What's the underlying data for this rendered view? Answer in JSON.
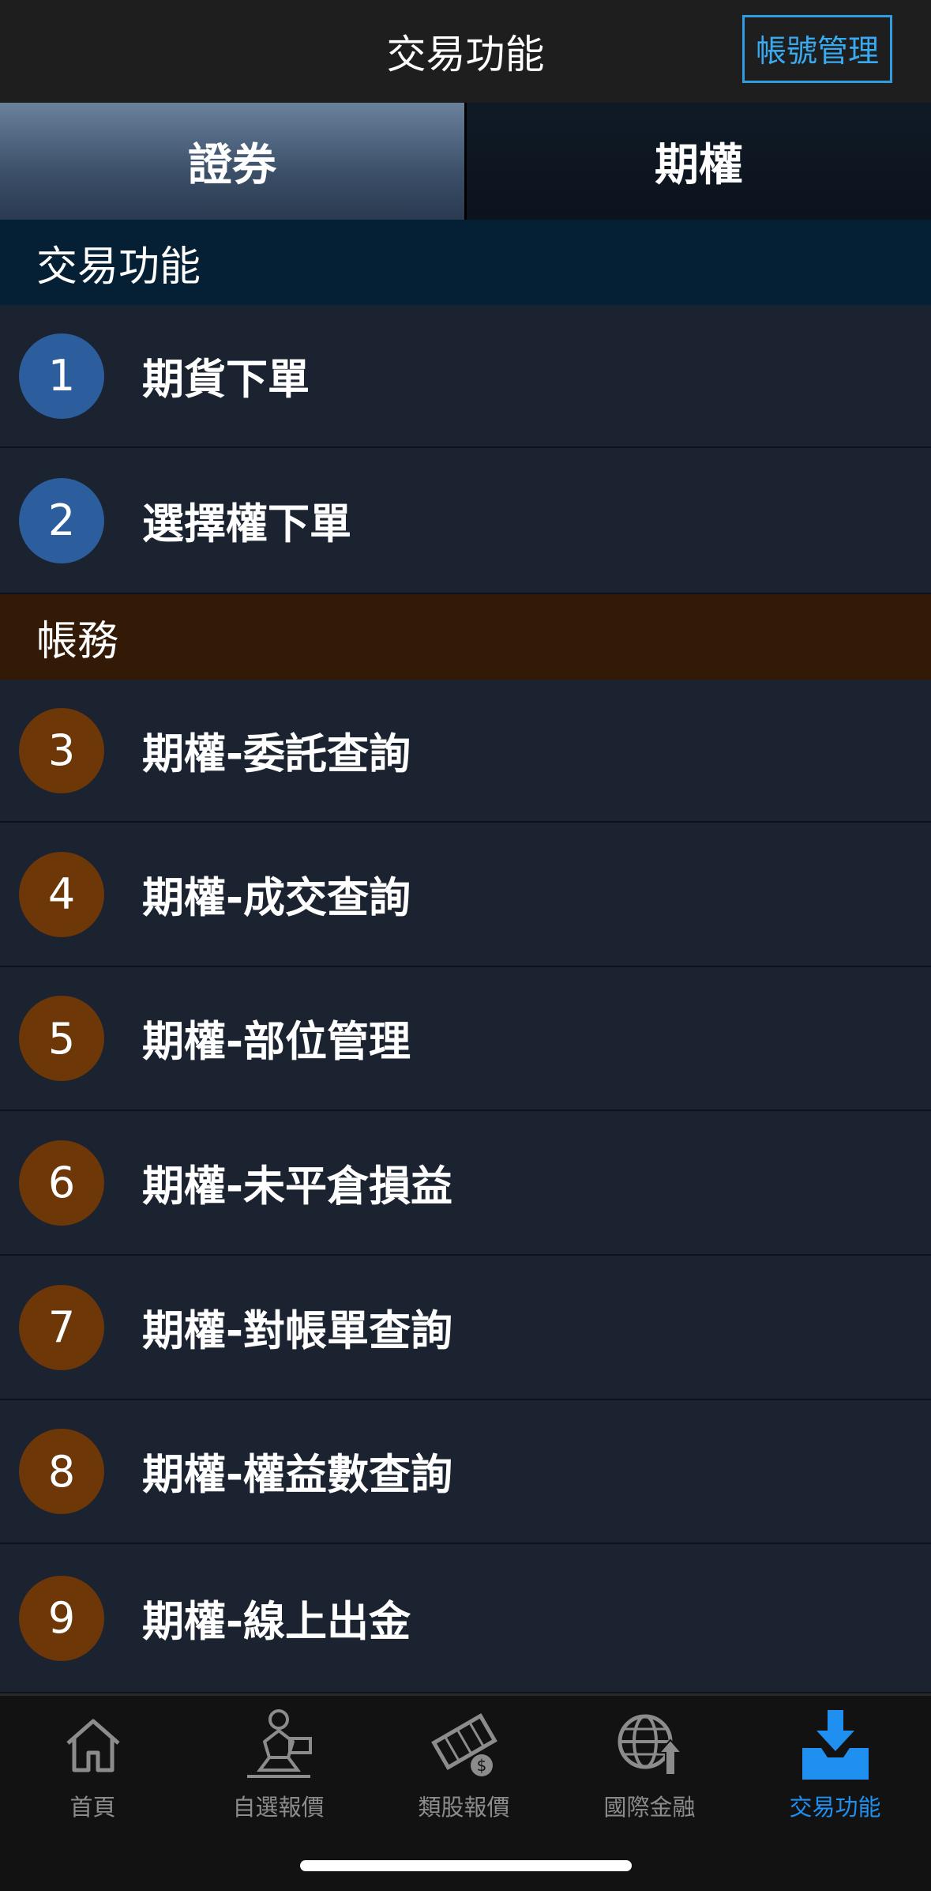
{
  "header": {
    "title": "交易功能",
    "account_button": "帳號管理"
  },
  "segments": [
    {
      "label": "證券",
      "active": true
    },
    {
      "label": "期權",
      "active": false
    }
  ],
  "sections": {
    "trade": {
      "title": "交易功能",
      "items": [
        {
          "num": "1",
          "label": "期貨下單"
        },
        {
          "num": "2",
          "label": "選擇權下單"
        }
      ]
    },
    "account": {
      "title": "帳務",
      "items": [
        {
          "num": "3",
          "label": "期權-委託查詢"
        },
        {
          "num": "4",
          "label": "期權-成交查詢"
        },
        {
          "num": "5",
          "label": "期權-部位管理"
        },
        {
          "num": "6",
          "label": "期權-未平倉損益"
        },
        {
          "num": "7",
          "label": "期權-對帳單查詢"
        },
        {
          "num": "8",
          "label": "期權-權益數查詢"
        },
        {
          "num": "9",
          "label": "期權-線上出金"
        }
      ]
    }
  },
  "tabbar": [
    {
      "label": "首頁",
      "icon": "home-icon",
      "active": false
    },
    {
      "label": "自選報價",
      "icon": "custom-quote-icon",
      "active": false
    },
    {
      "label": "類股報價",
      "icon": "film-dollar-icon",
      "active": false
    },
    {
      "label": "國際金融",
      "icon": "globe-up-icon",
      "active": false
    },
    {
      "label": "交易功能",
      "icon": "trade-download-icon",
      "active": true
    }
  ],
  "colors": {
    "accent": "#1f8ff0",
    "trade_circle": "#2c5d9c",
    "account_circle": "#6d3708",
    "trade_header": "#052035",
    "account_header": "#321a07"
  }
}
